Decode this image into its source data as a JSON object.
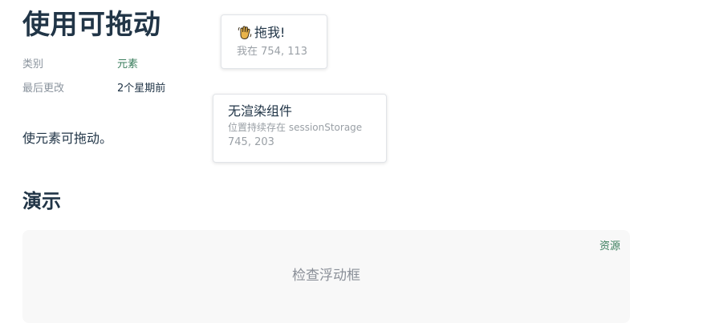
{
  "page": {
    "title": "使用可拖动",
    "meta": {
      "category_label": "类别",
      "category_value": "元素",
      "updated_label": "最后更改",
      "updated_value": "2个星期前"
    },
    "description": "使元素可拖动。",
    "demo_heading": "演示"
  },
  "demo": {
    "source_link": "资源",
    "inspect_text": "检查浮动框"
  },
  "draggable_card": {
    "icon": "waving-hand-icon",
    "label": "拖我!",
    "position": "我在 754, 113"
  },
  "renderless_card": {
    "label": "无渲染组件",
    "note": "位置持续存在 sessionStorage",
    "position": "745, 203"
  },
  "colors": {
    "text": "#213547",
    "muted": "#8b949e",
    "accent": "#3a7d5c",
    "demo_bg": "#f8f8f8"
  }
}
